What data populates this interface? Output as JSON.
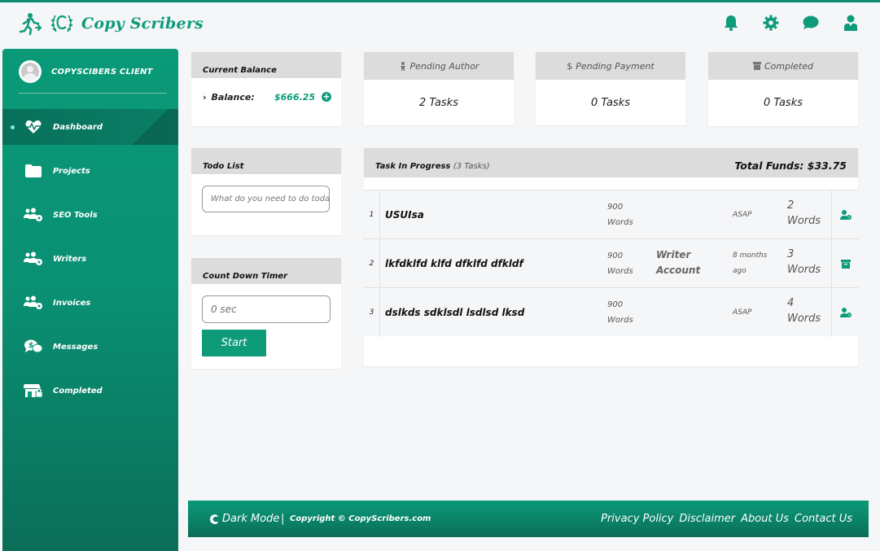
{
  "brand": {
    "name": "Copy Scribers"
  },
  "header": {
    "icons": [
      "bell-icon",
      "gear-icon",
      "chat-icon",
      "user-icon"
    ]
  },
  "sidebar": {
    "client_name": "COPYSCIBERS CLIENT",
    "items": [
      {
        "label": "Dashboard",
        "icon": "heartbeat-icon",
        "active": true
      },
      {
        "label": "Projects",
        "icon": "folder-icon"
      },
      {
        "label": "SEO Tools",
        "icon": "users-gear-icon"
      },
      {
        "label": "Writers",
        "icon": "users-gear-icon"
      },
      {
        "label": "Invoices",
        "icon": "users-gear-icon"
      },
      {
        "label": "Messages",
        "icon": "dollar-chat-icon"
      },
      {
        "label": "Completed",
        "icon": "store-lock-icon"
      }
    ]
  },
  "balance": {
    "title": "Current Balance",
    "label": "Balance:",
    "amount": "$666.25"
  },
  "stats": [
    {
      "title": "Pending Author",
      "value": "2 Tasks",
      "icon": "author-icon"
    },
    {
      "title": "Pending Payment",
      "value": "0 Tasks",
      "icon": "dollar-icon"
    },
    {
      "title": "Completed",
      "value": "0 Tasks",
      "icon": "box-icon"
    }
  ],
  "todo": {
    "title": "Todo List",
    "placeholder": "What do you need to do today?"
  },
  "timer": {
    "title": "Count Down Timer",
    "placeholder": "0 sec",
    "start_label": "Start"
  },
  "tasks": {
    "title": "Task In Progress",
    "count": "(3 Tasks)",
    "funds_label": "Total Funds:",
    "funds_value": "$33.75",
    "rows": [
      {
        "index": "1",
        "title": "USUIsa",
        "words_num": "900",
        "words_unit": "Words",
        "writer_1": "",
        "writer_2": "",
        "deadline_1": "ASAP",
        "deadline_2": "",
        "wc_num": "2",
        "wc_unit": "Words",
        "action_icon": "user-clock-icon"
      },
      {
        "index": "2",
        "title": "lkfdklfd klfd dfklfd dfkldf",
        "words_num": "900",
        "words_unit": "Words",
        "writer_1": "Writer",
        "writer_2": "Account",
        "deadline_1": "8 months",
        "deadline_2": "ago",
        "wc_num": "3",
        "wc_unit": "Words",
        "action_icon": "archive-icon"
      },
      {
        "index": "3",
        "title": "dslkds sdklsdl lsdlsd lksd",
        "words_num": "900",
        "words_unit": "Words",
        "writer_1": "",
        "writer_2": "",
        "deadline_1": "ASAP",
        "deadline_2": "",
        "wc_num": "4",
        "wc_unit": "Words",
        "action_icon": "user-clock-icon"
      }
    ]
  },
  "footer": {
    "dark_mode": "Dark Mode",
    "separator": "|",
    "copyright": "Copyright © CopyScribers.com",
    "links": [
      "Privacy Policy",
      "Disclaimer",
      "About Us",
      "Contact Us"
    ]
  },
  "colors": {
    "accent": "#0e9b7a",
    "sidebar": "#0a9a78",
    "card_header": "#dcdcdc",
    "background": "#f5f6f8"
  }
}
